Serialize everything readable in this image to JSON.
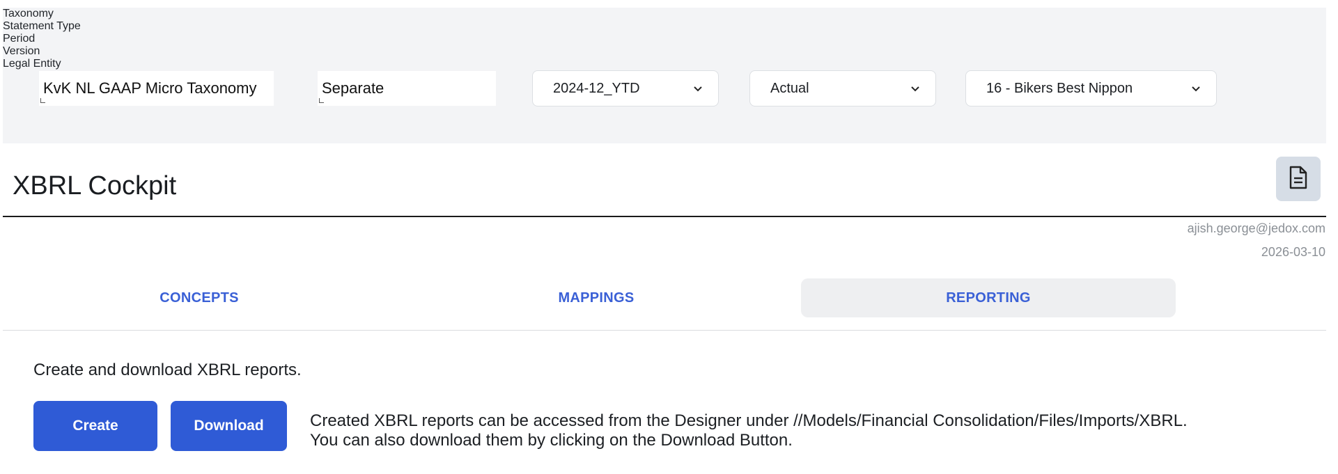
{
  "filters": {
    "taxonomy": {
      "label": "Taxonomy",
      "value": "KvK NL GAAP Micro Taxonomy"
    },
    "statement_type": {
      "label": "Statement Type",
      "value": "Separate"
    },
    "period": {
      "label": "Period",
      "value": "2024-12_YTD"
    },
    "version": {
      "label": "Version",
      "value": "Actual"
    },
    "legal_entity": {
      "label": "Legal Entity",
      "value": "16 - Bikers Best Nippon"
    }
  },
  "page": {
    "title": "XBRL Cockpit"
  },
  "meta": {
    "user": "ajish.george@jedox.com",
    "date": "2026-03-10"
  },
  "tabs": [
    {
      "label": "CONCEPTS",
      "active": false
    },
    {
      "label": "MAPPINGS",
      "active": false
    },
    {
      "label": "REPORTING",
      "active": true
    }
  ],
  "reporting": {
    "intro": "Create and download XBRL reports.",
    "create_label": "Create",
    "download_label": "Download",
    "help_line1": "Created XBRL reports can be accessed from the Designer under //Models/Financial Consolidation/Files/Imports/XBRL.",
    "help_line2": "You can also download them by clicking on the Download Button."
  },
  "colors": {
    "accent": "#2f5bd6",
    "tab_text": "#3a60d6",
    "filter_bg": "#f3f4f6"
  },
  "icons": {
    "document": "document-icon",
    "chevron": "chevron-down-icon"
  }
}
